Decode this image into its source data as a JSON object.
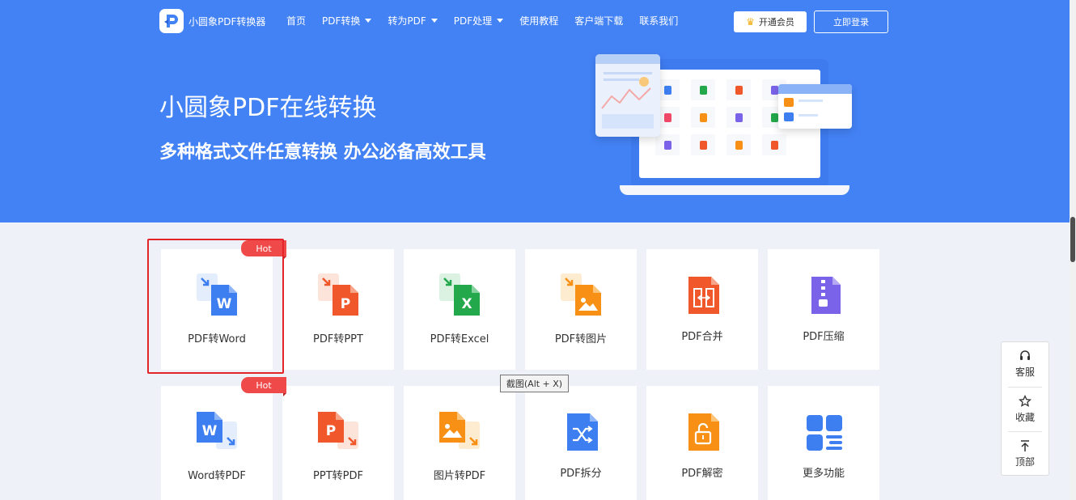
{
  "brand": {
    "name": "小圆象PDF转换器",
    "logo_letter": "P"
  },
  "nav": {
    "items": [
      {
        "label": "首页",
        "has_dropdown": false
      },
      {
        "label": "PDF转换",
        "has_dropdown": true
      },
      {
        "label": "转为PDF",
        "has_dropdown": true
      },
      {
        "label": "PDF处理",
        "has_dropdown": true
      },
      {
        "label": "使用教程",
        "has_dropdown": false
      },
      {
        "label": "客户端下载",
        "has_dropdown": false
      },
      {
        "label": "联系我们",
        "has_dropdown": false
      }
    ],
    "vip_label": "开通会员",
    "login_label": "立即登录"
  },
  "hero": {
    "title": "小圆象PDF在线转换",
    "subtitle": "多种格式文件任意转换 办公必备高效工具"
  },
  "tools": [
    {
      "label": "PDF转Word",
      "icon": "pdf-to-word-icon",
      "hot": true,
      "hot_label": "Hot",
      "color": "#3d7ef0"
    },
    {
      "label": "PDF转PPT",
      "icon": "pdf-to-ppt-icon",
      "hot": false,
      "color": "#f0572a"
    },
    {
      "label": "PDF转Excel",
      "icon": "pdf-to-excel-icon",
      "hot": false,
      "color": "#23a84c"
    },
    {
      "label": "PDF转图片",
      "icon": "pdf-to-image-icon",
      "hot": false,
      "color": "#f79015"
    },
    {
      "label": "PDF合并",
      "icon": "pdf-merge-icon",
      "hot": false,
      "color": "#f0572a"
    },
    {
      "label": "PDF压缩",
      "icon": "pdf-compress-icon",
      "hot": false,
      "color": "#7a63e8"
    },
    {
      "label": "Word转PDF",
      "icon": "word-to-pdf-icon",
      "hot": true,
      "hot_label": "Hot",
      "color": "#3d7ef0"
    },
    {
      "label": "PPT转PDF",
      "icon": "ppt-to-pdf-icon",
      "hot": false,
      "color": "#f0572a"
    },
    {
      "label": "图片转PDF",
      "icon": "image-to-pdf-icon",
      "hot": false,
      "color": "#f79015"
    },
    {
      "label": "PDF拆分",
      "icon": "pdf-split-icon",
      "hot": false,
      "color": "#3d7ef0"
    },
    {
      "label": "PDF解密",
      "icon": "pdf-decrypt-icon",
      "hot": false,
      "color": "#f79015"
    },
    {
      "label": "更多功能",
      "icon": "more-features-icon",
      "hot": false,
      "color": "#3d7ef0"
    }
  ],
  "tooltip": "截图(Alt + X)",
  "side": {
    "service": "客服",
    "favorite": "收藏",
    "top": "顶部"
  },
  "colors": {
    "hero_bg": "#4382f5",
    "page_bg": "#eef2f8",
    "hot_badge": "#f04949",
    "highlight": "#e3252a"
  }
}
